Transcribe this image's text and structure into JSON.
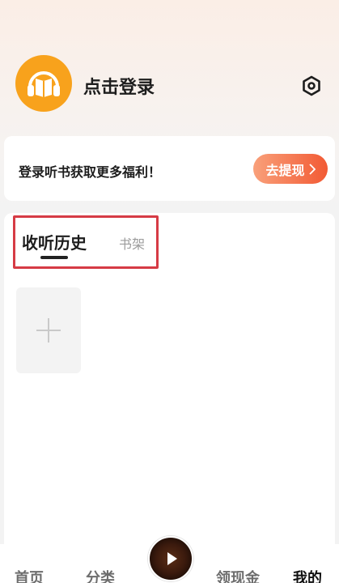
{
  "header": {
    "login_label": "点击登录",
    "avatar_icon": "headphones-book-icon",
    "settings_icon": "gear-icon"
  },
  "promo": {
    "text": "登录听书获取更多福利！",
    "button_label": "去提现",
    "button_icon": "chevron-right-icon"
  },
  "tabs": {
    "history": "收听历史",
    "shelf": "书架"
  },
  "add_card": {
    "icon": "plus-icon"
  },
  "bottom_nav": {
    "items": [
      "首页",
      "分类",
      "领现金",
      "我的"
    ],
    "active": "我的",
    "player_icon": "play-icon"
  },
  "colors": {
    "accent_orange": "#f25a34",
    "avatar_orange": "#f8a21c",
    "highlight_border": "#d63b45"
  }
}
